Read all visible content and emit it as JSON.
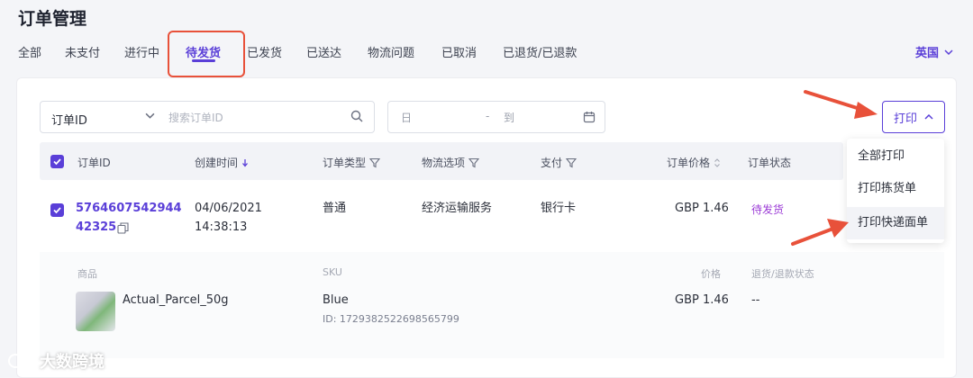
{
  "page": {
    "title": "订单管理"
  },
  "tabs": [
    {
      "label": "全部"
    },
    {
      "label": "未支付"
    },
    {
      "label": "进行中"
    },
    {
      "label": "待发货"
    },
    {
      "label": "已发货"
    },
    {
      "label": "已送达"
    },
    {
      "label": "物流问题"
    },
    {
      "label": "已取消"
    },
    {
      "label": "已退货/已退款"
    }
  ],
  "active_tab": "待发货",
  "region": {
    "label": "英国"
  },
  "filters": {
    "field_select": "订单ID",
    "search_placeholder": "搜索订单ID",
    "date_start": "日",
    "date_sep": "-",
    "date_end": "到"
  },
  "print": {
    "label": "打印",
    "menu": [
      {
        "label": "全部打印"
      },
      {
        "label": "打印拣货单"
      },
      {
        "label": "打印快递面单"
      }
    ]
  },
  "table": {
    "columns": {
      "order_id": "订单ID",
      "created": "创建时间",
      "type": "订单类型",
      "logistics": "物流选项",
      "payment": "支付",
      "price": "订单价格",
      "status": "订单状态"
    },
    "rows": [
      {
        "order_id_line1": "5764607542944",
        "order_id_line2": "42325",
        "date": "04/06/2021",
        "time": "14:38:13",
        "type": "普通",
        "logistics": "经济运输服务",
        "payment": "银行卡",
        "price": "GBP 1.46",
        "status": "待发货",
        "items_header": {
          "product": "商品",
          "sku": "SKU",
          "price": "价格",
          "refund_status": "退货/退款状态"
        },
        "items": [
          {
            "name": "Actual_Parcel_50g",
            "sku": "Blue",
            "sku_id": "ID: 1729382522698565799",
            "price": "GBP 1.46",
            "refund_status": "--"
          }
        ]
      }
    ]
  },
  "watermark": {
    "text": "大数跨境"
  },
  "colors": {
    "accent": "#5a3fd8",
    "annotation": "#e8513a",
    "status": "#9b3bd6"
  }
}
